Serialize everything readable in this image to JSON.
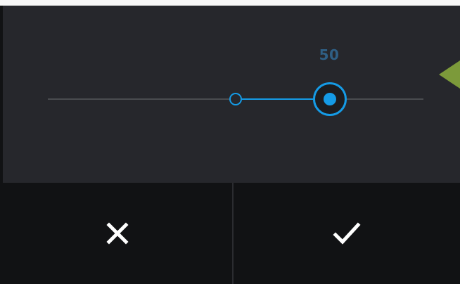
{
  "slider": {
    "value_label": "50",
    "min": 0,
    "max": 100,
    "start_value": 50,
    "end_value": 75
  },
  "colors": {
    "accent": "#159be6",
    "panel": "#26272c",
    "footer": "#111214",
    "pointer": "#7c9a3a"
  },
  "buttons": {
    "cancel_icon": "close-icon",
    "confirm_icon": "check-icon"
  }
}
